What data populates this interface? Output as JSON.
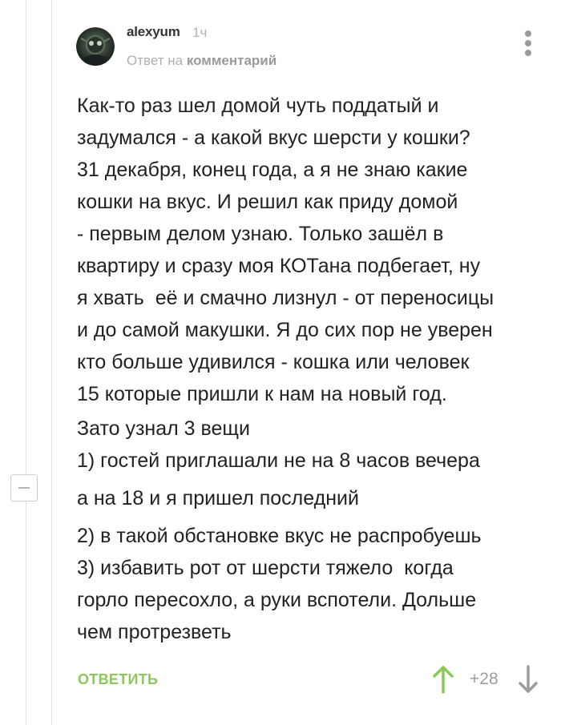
{
  "comment": {
    "author": "alexyum",
    "time": "1ч",
    "reply_prefix": "Ответ на ",
    "reply_target": "комментарий",
    "body_lines": [
      "Как-то раз шел домой чуть поддатый и",
      "задумался - а какой вкус шерсти у кошки?",
      "31 декабря, конец года, а я не знаю какие",
      "кошки на вкус. И решил как приду домой",
      "- первым делом узнаю. Только зашёл в",
      "квартиру и сразу моя КОТана подбегает, ну",
      "я хвать  её и смачно лизнул - от переносицы",
      "и до самой макушки. Я до сих пор не уверен",
      "кто больше удивился - кошка или человек",
      "15 которые пришли к нам на новый год.",
      "Зато узнал 3 вещи",
      "1) гостей приглашали не на 8 часов вечера",
      "а на 18 и я пришел последний",
      "2) в такой обстановке вкус не распробуешь",
      "3) избавить рот от шерсти тяжело  когда",
      "горло пересохло, а руки вспотели. Дольше",
      "чем протрезветь"
    ]
  },
  "actions": {
    "reply_label": "ОТВЕТИТЬ",
    "rating": "+28",
    "upvote_icon": "arrow-up-icon",
    "downvote_icon": "arrow-down-icon",
    "more_icon": "vertical-dots-icon",
    "collapse_icon": "minus-box-icon"
  },
  "colors": {
    "accent_green": "#8ac858",
    "meta_gray": "#b0b0b0",
    "text": "#222222"
  }
}
